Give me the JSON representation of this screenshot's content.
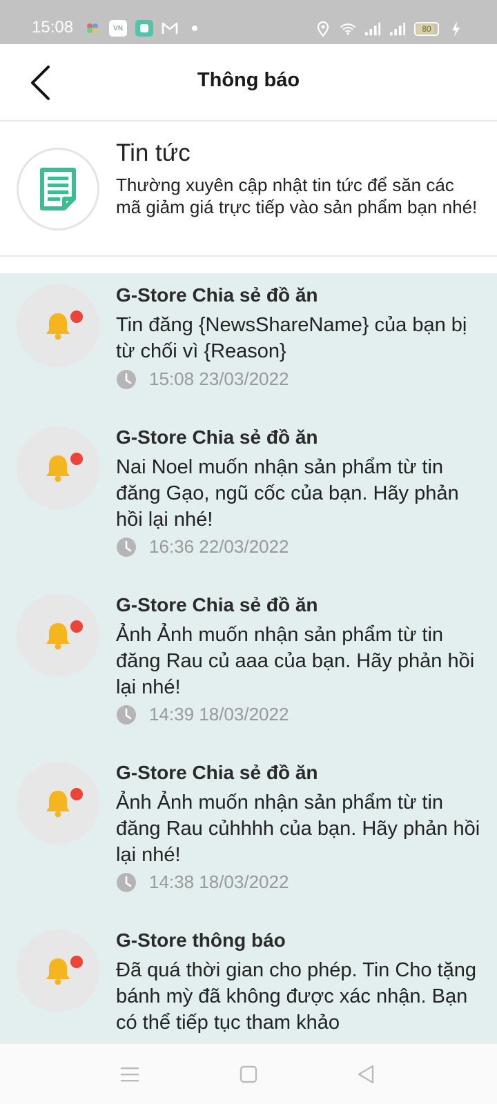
{
  "status_bar": {
    "time": "15:08",
    "battery": "80",
    "icons": [
      "photos-icon",
      "vtv-app-icon",
      "green-app-icon",
      "gmail-icon",
      "notification-dot-icon",
      "location-icon",
      "wifi-icon",
      "signal-icon",
      "signal-icon",
      "battery-icon",
      "charging-icon"
    ]
  },
  "header": {
    "title": "Thông báo"
  },
  "news": {
    "title": "Tin tức",
    "description": "Thường xuyên cập nhật tin tức để săn các mã giảm giá trực tiếp vào sản phẩm bạn nhé!"
  },
  "notifications": [
    {
      "sender": "G-Store Chia sẻ đồ ăn",
      "message": "Tin đăng {NewsShareName} của bạn bị từ chối vì {Reason}",
      "time": "15:08 23/03/2022"
    },
    {
      "sender": "G-Store Chia sẻ đồ ăn",
      "message": "Nai Noel muốn nhận sản phẩm từ tin đăng Gạo, ngũ cốc  của bạn. Hãy phản hồi lại nhé!",
      "time": "16:36 22/03/2022"
    },
    {
      "sender": "G-Store Chia sẻ đồ ăn",
      "message": "Ảnh Ảnh muốn nhận sản phẩm từ tin đăng Rau củ aaa của bạn. Hãy phản hồi lại nhé!",
      "time": "14:39 18/03/2022"
    },
    {
      "sender": "G-Store Chia sẻ đồ ăn",
      "message": "Ảnh Ảnh muốn nhận sản phẩm từ tin đăng Rau củhhhh của bạn. Hãy phản hồi lại nhé!",
      "time": "14:38 18/03/2022"
    },
    {
      "sender": "G-Store thông báo",
      "message": "Đã quá thời gian cho phép. Tin Cho tặng bánh mỳ đã không được xác nhận. Bạn có thể tiếp tục tham khảo",
      "time": ""
    }
  ],
  "colors": {
    "list_background": "#e2efee",
    "news_icon": "#3dbb93",
    "bell": "#f5b51f",
    "unread_dot": "#ec4438",
    "status_bar": "#c2c2c2"
  },
  "nav": {
    "icons": [
      "menu-icon",
      "home-square-icon",
      "back-triangle-icon"
    ]
  }
}
